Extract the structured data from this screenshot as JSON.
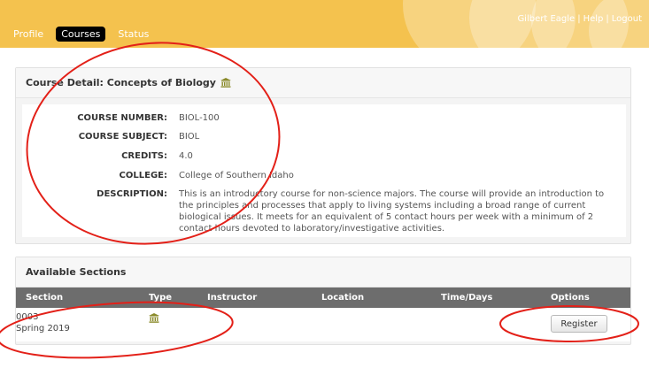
{
  "header": {
    "nav": [
      "Profile",
      "Courses",
      "Status"
    ],
    "active_nav": "Courses",
    "user": "Gilbert Eagle",
    "help": "Help",
    "logout": "Logout",
    "separator": "|",
    "bg_color": "#f4c24e"
  },
  "course_detail": {
    "title": "Course Detail: Concepts of Biology",
    "fields": [
      {
        "label": "COURSE NUMBER:",
        "value": "BIOL-100"
      },
      {
        "label": "COURSE SUBJECT:",
        "value": "BIOL"
      },
      {
        "label": "CREDITS:",
        "value": "4.0"
      },
      {
        "label": "COLLEGE:",
        "value": "College of Southern Idaho"
      },
      {
        "label": "DESCRIPTION:",
        "value": "This is an introductory course for non-science majors. The course will provide an introduction to the principles and processes that apply to living systems including a broad range of current biological issues. It meets for an equivalent of 5 contact hours per week with a minimum of 2 contact hours devoted to laboratory/investigative activities."
      }
    ],
    "icon": "institution-icon"
  },
  "sections": {
    "title": "Available Sections",
    "columns": [
      "Section",
      "Type",
      "Instructor",
      "Location",
      "Time/Days",
      "Options"
    ],
    "rows": [
      {
        "section": "0003",
        "term": "Spring 2019",
        "type_icon": "institution-icon",
        "instructor": "",
        "location": "",
        "time_days": "",
        "action": "Register"
      }
    ]
  },
  "annotation_color": "#e32018"
}
